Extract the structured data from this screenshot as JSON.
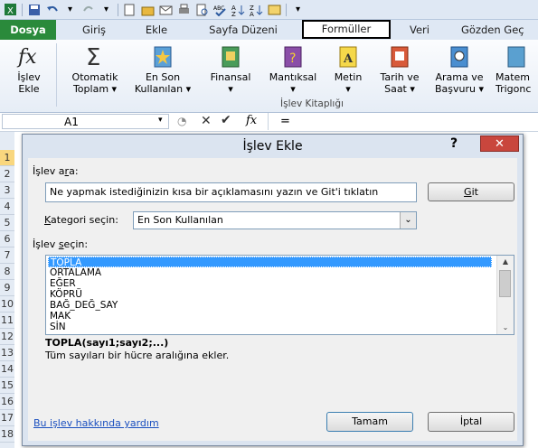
{
  "tabs": {
    "dosya": "Dosya",
    "giris": "Giriş",
    "ekle": "Ekle",
    "sayfa_duzeni": "Sayfa Düzeni",
    "formuller": "Formüller",
    "veri": "Veri",
    "gozden_gecir": "Gözden Geç"
  },
  "ribbon": {
    "islev_ekle": [
      "İşlev",
      "Ekle"
    ],
    "otomatik_toplam": [
      "Otomatik",
      "Toplam ▾"
    ],
    "en_son": [
      "En Son",
      "Kullanılan ▾"
    ],
    "finansal": [
      "Finansal",
      "▾"
    ],
    "mantiksal": [
      "Mantıksal",
      "▾"
    ],
    "metin": [
      "Metin",
      "▾"
    ],
    "tarih": [
      "Tarih ve",
      "Saat ▾"
    ],
    "arama": [
      "Arama ve",
      "Başvuru ▾"
    ],
    "matematik": [
      "Matem",
      "Trigonc"
    ],
    "group_label": "İşlev Kitaplığı"
  },
  "formula_bar": {
    "cell_ref": "A1",
    "fx": "fx",
    "equals": "="
  },
  "row_numbers": [
    "1",
    "2",
    "3",
    "4",
    "5",
    "6",
    "7",
    "8",
    "9",
    "10",
    "11",
    "12",
    "13",
    "14",
    "15",
    "16",
    "17",
    "18"
  ],
  "dialog": {
    "title": "İşlev Ekle",
    "help": "?",
    "close": "✕",
    "search_label_pre": "İşlev a",
    "search_label_u": "r",
    "search_label_post": "a:",
    "search_value": "Ne yapmak istediğinizin kısa bir açıklamasını yazın ve Git'i tıklatın",
    "git_u": "G",
    "git_post": "it",
    "category_label_u": "K",
    "category_label_post": "ategori seçin:",
    "category_value": "En Son Kullanılan",
    "select_label_pre": "İşlev ",
    "select_label_u": "s",
    "select_label_post": "eçin:",
    "functions": [
      "TOPLA",
      "ORTALAMA",
      "EĞER",
      "KÖPRÜ",
      "BAĞ_DEĞ_SAY",
      "MAK",
      "SİN"
    ],
    "selected_index": 0,
    "signature": "TOPLA(sayı1;sayı2;...)",
    "description": "Tüm sayıları bir hücre aralığına ekler.",
    "help_link": "Bu işlev hakkında yardım",
    "ok": "Tamam",
    "cancel": "İptal"
  },
  "colors": {
    "dosya_tab": "#2a8a3b",
    "selection": "#3399ff",
    "close_button": "#c9463d",
    "link": "#1a4fbf"
  }
}
